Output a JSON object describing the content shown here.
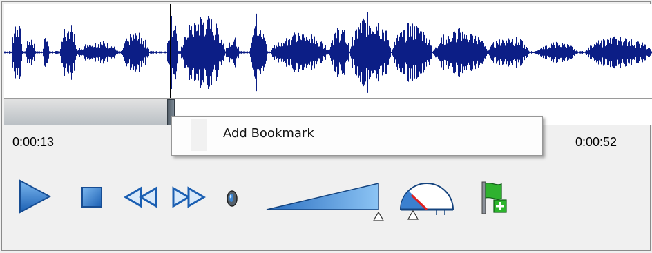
{
  "waveform": {
    "color": "#0c1e86"
  },
  "seek": {
    "position_fraction": 0.25
  },
  "times": {
    "current": "0:00:13",
    "total": "0:00:52"
  },
  "context_menu": {
    "items": [
      {
        "label": "Add Bookmark"
      }
    ]
  },
  "controls": {
    "play": "play-icon",
    "stop": "stop-icon",
    "rewind": "rewind-icon",
    "fast_forward": "fast-forward-icon",
    "mute": "speaker-icon",
    "volume": "volume-slider",
    "speed": "speed-gauge-icon",
    "bookmark": "add-bookmark-flag-icon"
  },
  "colors": {
    "accent": "#2f7fd2",
    "flag": "#2fb22f",
    "plus": "#1a8a1a",
    "needle": "#e02020"
  }
}
